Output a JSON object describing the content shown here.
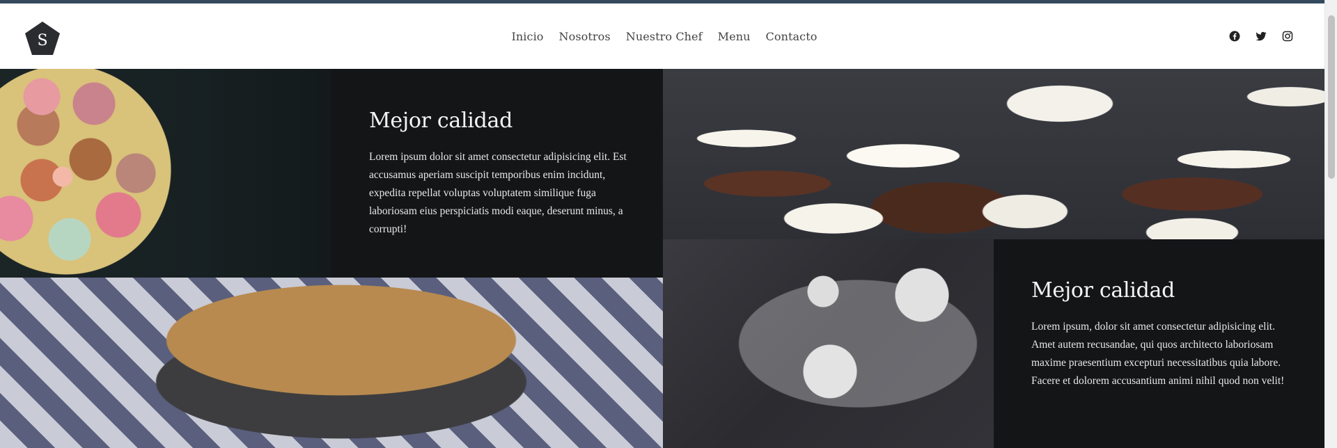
{
  "header": {
    "logo_letter": "S",
    "nav": [
      {
        "label": "Inicio"
      },
      {
        "label": "Nosotros"
      },
      {
        "label": "Nuestro Chef"
      },
      {
        "label": "Menu"
      },
      {
        "label": "Contacto"
      }
    ],
    "socials": [
      "facebook-icon",
      "twitter-icon",
      "instagram-icon"
    ]
  },
  "sections": [
    {
      "title": "Mejor calidad",
      "text": "Lorem ipsum dolor sit amet consectetur adipisicing elit. Est accusamus aperiam suscipit temporibus enim incidunt, expedita repellat voluptas voluptatem similique fuga laboriosam eius perspiciatis modi eaque, deserunt minus, a corrupti!"
    },
    {
      "title": "Mejor calidad",
      "text": "Lorem ipsum, dolor sit amet consectetur adipisicing elit. Amet autem recusandae, qui quos architecto laboriosam maxime praesentium excepturi necessitatibus quia labore. Facere et dolorem accusantium animi nihil quod non velit!"
    }
  ],
  "colors": {
    "dark_panel": "#141517",
    "top_strip": "#34495e",
    "nav_text": "#444444"
  }
}
